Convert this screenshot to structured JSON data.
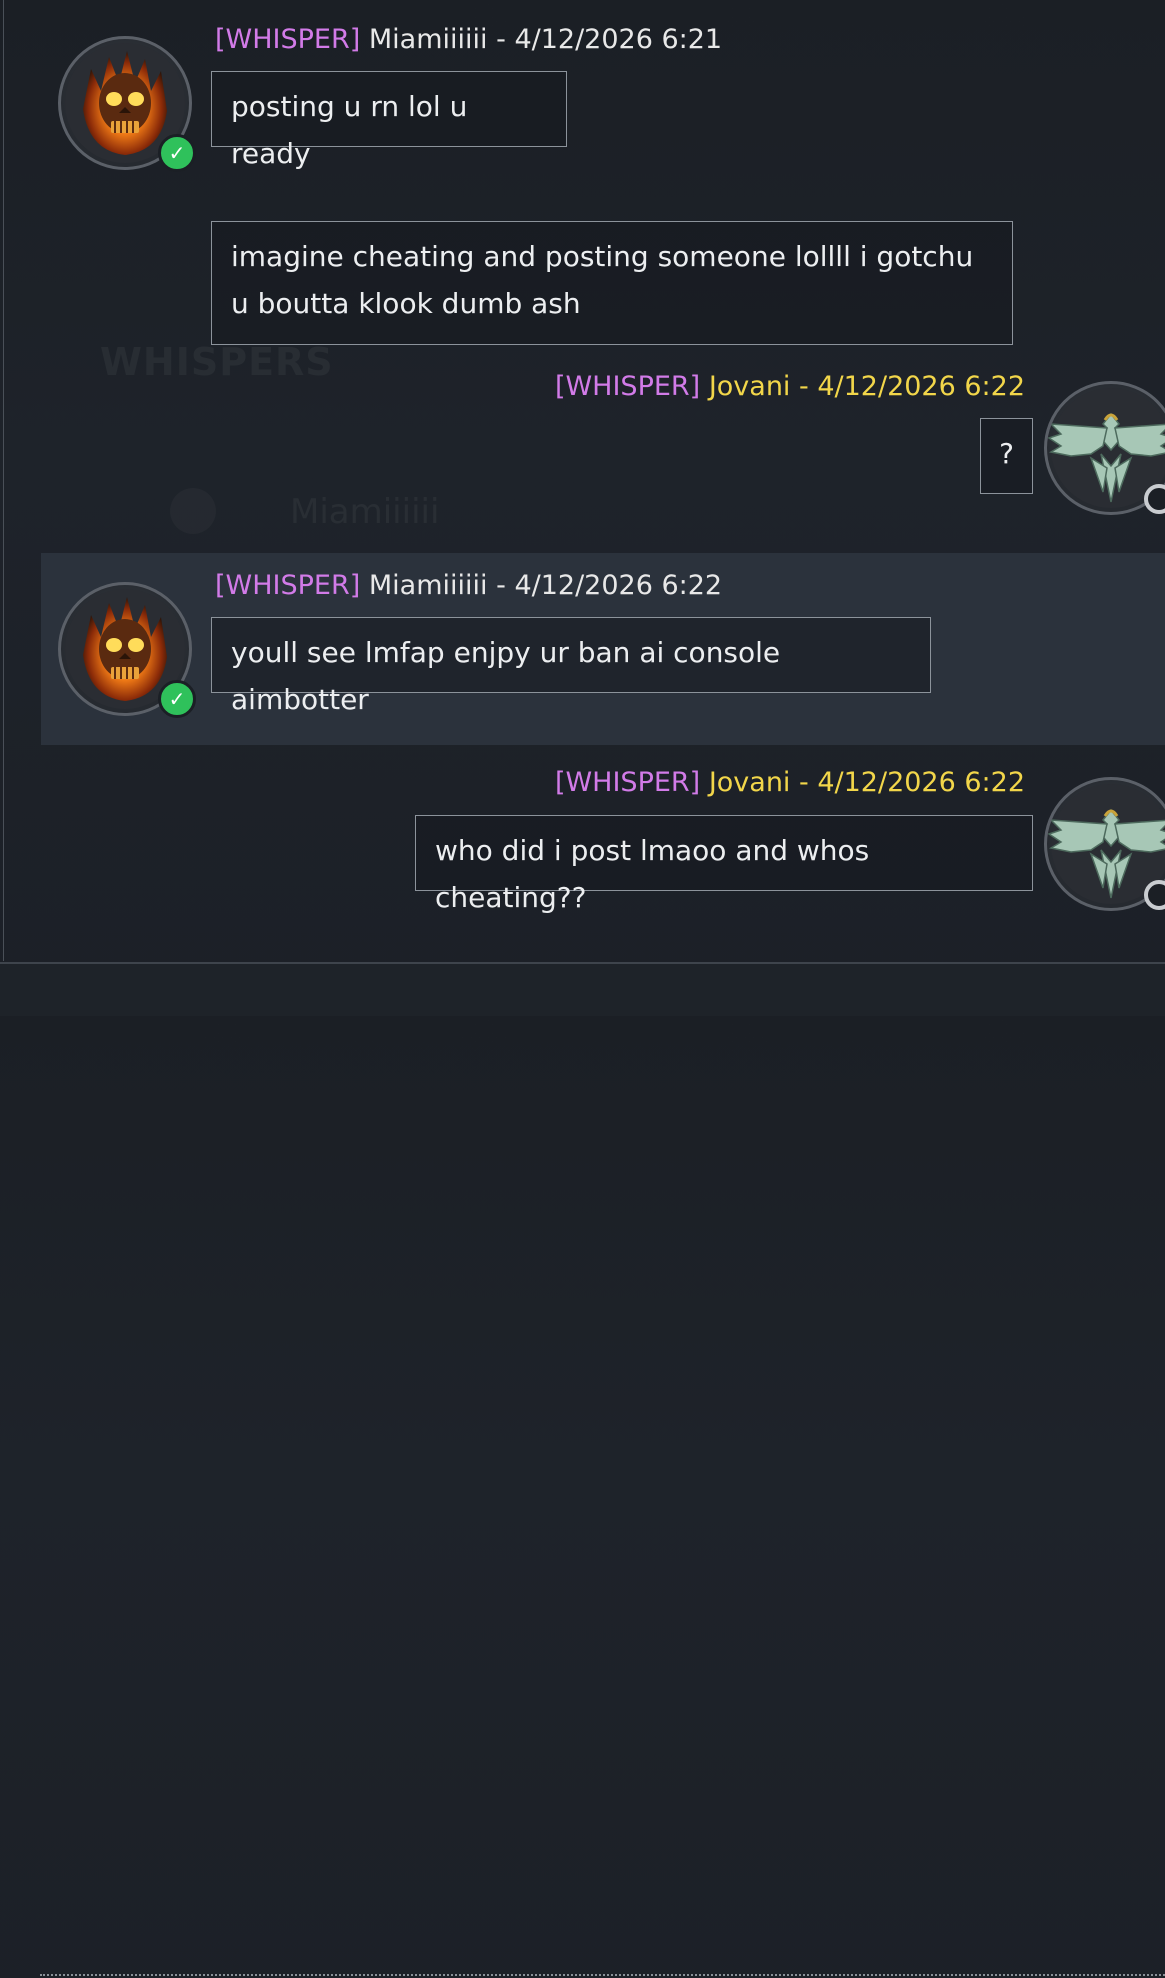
{
  "messages": [
    {
      "tag": "[WHISPER]",
      "sender": "Miamiiiiii",
      "timestamp": " - 4/12/2026 6:21",
      "bubbles": [
        "posting u rn lol u ready",
        "imagine cheating and posting someone lollll i gotchu u boutta klook dumb ash"
      ],
      "side": "left",
      "avatar": "flaming-skull-icon",
      "status": "online"
    },
    {
      "tag": "[WHISPER]",
      "sender": "Jovani",
      "timestamp": " - 4/12/2026 6:22",
      "bubbles": [
        "?"
      ],
      "side": "right",
      "avatar": "eagle-emblem-icon",
      "status": "offline"
    },
    {
      "tag": "[WHISPER]",
      "sender": "Miamiiiiii",
      "timestamp": " - 4/12/2026 6:22",
      "bubbles": [
        "youll see lmfap enjpy ur ban ai console aimbotter"
      ],
      "side": "left",
      "avatar": "flaming-skull-icon",
      "status": "online",
      "highlighted": true
    },
    {
      "tag": "[WHISPER]",
      "sender": "Jovani",
      "timestamp": " - 4/12/2026 6:22",
      "bubbles": [
        "who did i post lmaoo and whos cheating??"
      ],
      "side": "right",
      "avatar": "eagle-emblem-icon",
      "status": "offline"
    }
  ],
  "background_ghost": {
    "heading": "WHISPERS",
    "contact": "Miamiiiiii"
  },
  "colors": {
    "whisper_tag": "#d27be8",
    "self_name": "#f2d64a",
    "online": "#2fc15b"
  }
}
